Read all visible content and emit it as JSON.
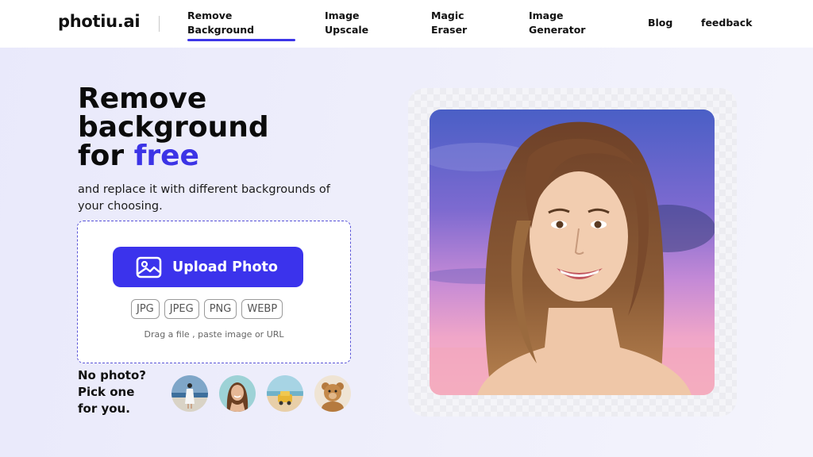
{
  "header": {
    "logo": "photiu.ai",
    "nav": [
      {
        "label": "Remove\nBackground"
      },
      {
        "label": "Image\nUpscale"
      },
      {
        "label": "Magic\nEraser"
      },
      {
        "label": "Image\nGenerator"
      },
      {
        "label": "Blog"
      },
      {
        "label": "feedback"
      }
    ],
    "active_index": 0
  },
  "hero": {
    "title_line1": "Remove",
    "title_line2": "background",
    "title_line3_prefix": "for ",
    "title_line3_accent": "free",
    "subtitle": "and replace it with different backgrounds of your choosing."
  },
  "upload": {
    "button_label": "Upload Photo",
    "formats": [
      "JPG",
      "JPEG",
      "PNG",
      "WEBP"
    ],
    "hint": "Drag a file , paste image or URL"
  },
  "samples": {
    "prompt": "No photo?\nPick one\nfor you.",
    "items": [
      {
        "icon": "sample-woman-beach-thumbnail"
      },
      {
        "icon": "sample-portrait-woman-thumbnail"
      },
      {
        "icon": "sample-car-beach-thumbnail"
      },
      {
        "icon": "sample-teddy-bear-thumbnail"
      }
    ]
  },
  "preview": {
    "icon": "smiling-woman-sunset-portrait"
  },
  "colors": {
    "accent": "#3b33ec",
    "text": "#111111"
  }
}
